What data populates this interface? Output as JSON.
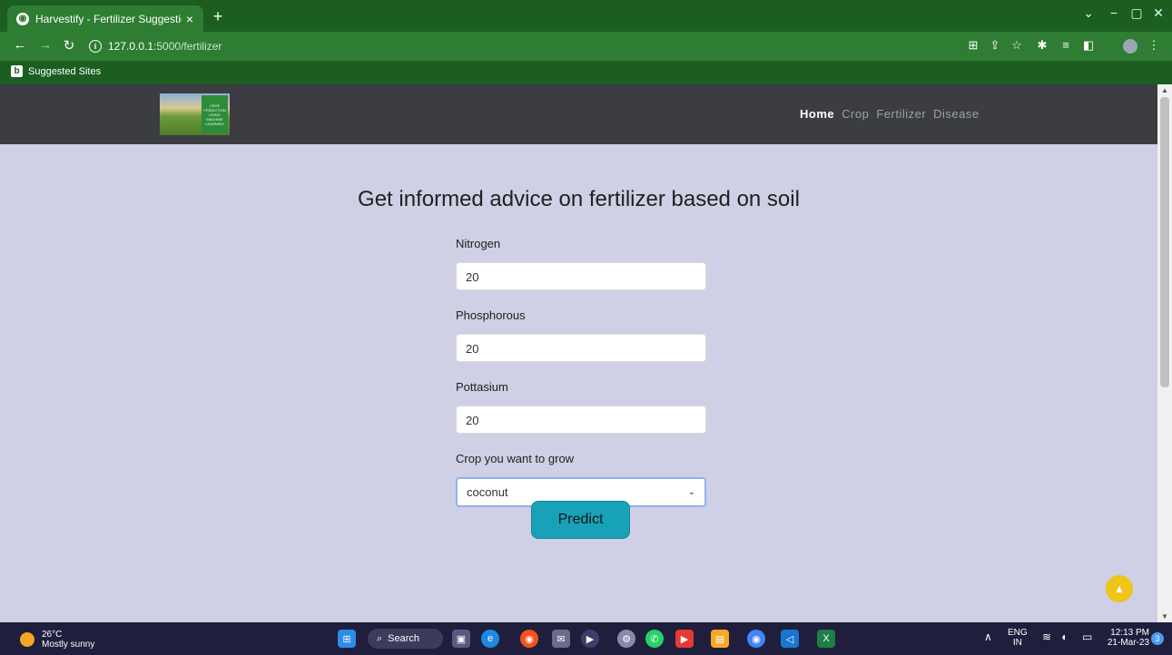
{
  "browser": {
    "tab_title": "Harvestify - Fertilizer Suggestion",
    "tab_close": "×",
    "new_tab": "+",
    "url_host": "127.0.0.1",
    "url_path": ":5000/fertilizer",
    "bookmark_label": "Suggested Sites",
    "accent_color": "#2e7d32"
  },
  "site": {
    "logo_text": "CROP PREDICTION USING MACHINE LEARNING",
    "nav": [
      "Home",
      "Crop",
      "Fertilizer",
      "Disease"
    ],
    "active_nav": "Home"
  },
  "page": {
    "heading": "Get informed advice on fertilizer based on soil",
    "fields": [
      {
        "label": "Nitrogen",
        "value": "20"
      },
      {
        "label": "Phosphorous",
        "value": "20"
      },
      {
        "label": "Pottasium",
        "value": "20"
      }
    ],
    "crop_label": "Crop you want to grow",
    "crop_selected": "coconut",
    "predict_label": "Predict"
  },
  "taskbar": {
    "weather_temp": "26°C",
    "weather_desc": "Mostly sunny",
    "search_label": "Search",
    "lang_top": "ENG",
    "lang_bottom": "IN",
    "time": "12:13 PM",
    "date": "21-Mar-23",
    "notification_count": "3"
  }
}
